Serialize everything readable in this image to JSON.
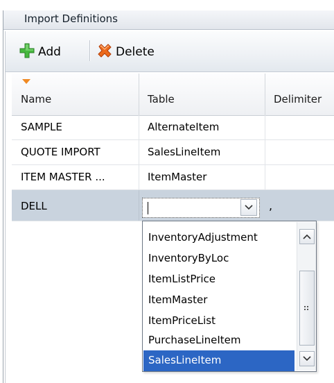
{
  "panel": {
    "title": "Import Definitions"
  },
  "toolbar": {
    "add_label": "Add",
    "delete_label": "Delete"
  },
  "grid": {
    "columns": [
      "Name",
      "Table",
      "Delimiter"
    ],
    "rows": [
      {
        "name": "SAMPLE",
        "table": "AlternateItem",
        "delimiter": ""
      },
      {
        "name": "QUOTE IMPORT",
        "table": "SalesLineItem",
        "delimiter": ""
      },
      {
        "name": "ITEM MASTER ...",
        "table": "ItemMaster",
        "delimiter": ""
      },
      {
        "name": "DELL",
        "table": "",
        "delimiter": ","
      }
    ],
    "selected_row": 3,
    "sort_column": "Name"
  },
  "dropdown": {
    "options": [
      "InventoryAdjustment",
      "InventoryByLoc",
      "ItemListPrice",
      "ItemMaster",
      "ItemPriceList",
      "PurchaseLineItem",
      "SalesLineItem"
    ],
    "highlighted": "SalesLineItem"
  },
  "colors": {
    "selection": "#2c66c4",
    "selected_row": "#c9d3de",
    "add_icon": "#3aa635",
    "delete_icon": "#e05a10",
    "sort_arrow": "#f08a24"
  }
}
